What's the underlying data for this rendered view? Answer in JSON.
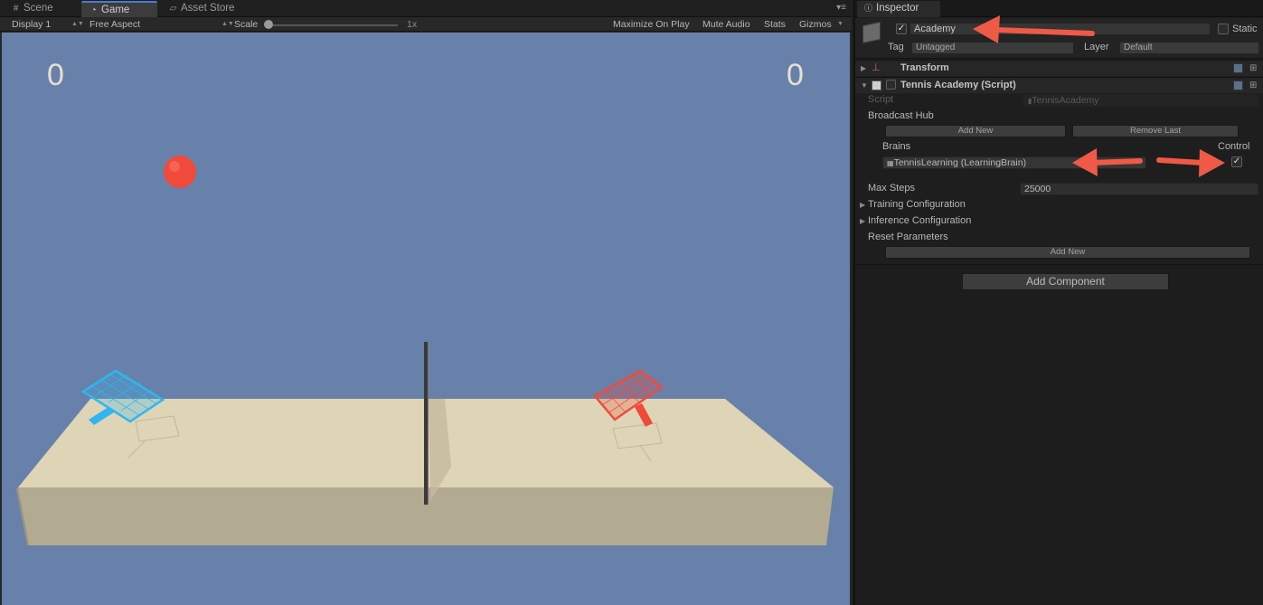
{
  "game_tabs": [
    {
      "label": "Scene",
      "icon": "hash-icon"
    },
    {
      "label": "Game",
      "icon": "pacman-icon"
    },
    {
      "label": "Asset Store",
      "icon": "bag-icon"
    }
  ],
  "game_toolbar": {
    "display": "Display 1",
    "aspect": "Free Aspect",
    "scale_label": "Scale",
    "scale_value": "1x",
    "maximize": "Maximize On Play",
    "mute": "Mute Audio",
    "stats": "Stats",
    "gizmos": "Gizmos"
  },
  "scores": {
    "left": "0",
    "right": "0"
  },
  "colors": {
    "sky": "#6881aa",
    "court": "#ded4b6",
    "ball": "#f04a3a",
    "blue_racket": "#2fb6f0",
    "red_racket": "#f04a3a",
    "arrow": "#ee5a45"
  },
  "inspector": {
    "tab_label": "Inspector",
    "object_name": "Academy",
    "object_active": true,
    "static_label": "Static",
    "tag_label": "Tag",
    "tag_value": "Untagged",
    "layer_label": "Layer",
    "layer_value": "Default",
    "components": {
      "transform": {
        "title": "Transform"
      },
      "academy": {
        "title": "Tennis Academy (Script)",
        "script_label": "Script",
        "script_value": "TennisAcademy",
        "broadcast_hub_label": "Broadcast Hub",
        "add_new_label": "Add New",
        "remove_last_label": "Remove Last",
        "brains_label": "Brains",
        "control_label": "Control",
        "brain_value": "TennisLearning (LearningBrain)",
        "control_checked": true,
        "max_steps_label": "Max Steps",
        "max_steps_value": "25000",
        "training_config_label": "Training Configuration",
        "inference_config_label": "Inference Configuration",
        "reset_params_label": "Reset Parameters",
        "reset_add_new_label": "Add New"
      }
    },
    "add_component_label": "Add Component"
  }
}
